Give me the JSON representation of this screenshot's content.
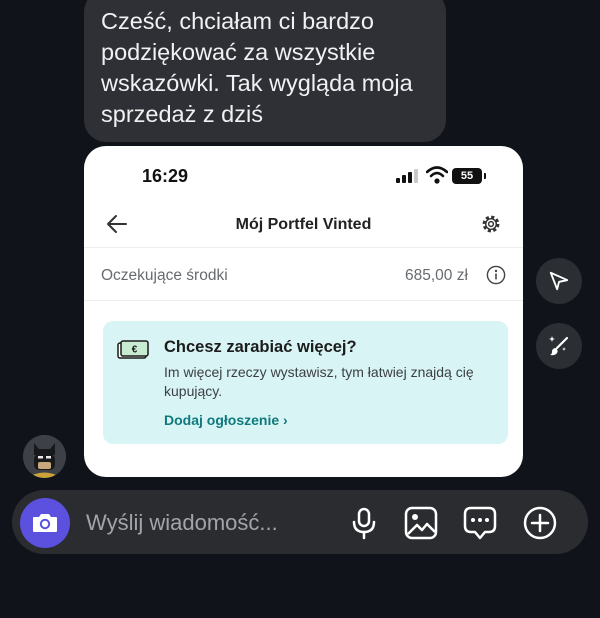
{
  "message": {
    "text": "Cześć, chciałam ci bardzo podziękować za wszystkie wskazówki. Tak wygląda moja sprzedaż z dziś"
  },
  "screenshot": {
    "status_bar": {
      "time": "16:29",
      "battery": "55"
    },
    "header": {
      "title": "Mój Portfel Vinted"
    },
    "pending": {
      "label": "Oczekujące środki",
      "amount": "685,00 zł"
    },
    "promo": {
      "title": "Chcesz zarabiać więcej?",
      "text": "Im więcej rzeczy wystawisz, tym łatwiej znajdą cię kupujący.",
      "link": "Dodaj ogłoszenie ›"
    }
  },
  "composer": {
    "placeholder": "Wyślij wiadomość..."
  },
  "icons": {
    "share": "paper-plane-icon",
    "ai_edit": "magic-brush-icon",
    "camera": "camera-icon",
    "mic": "microphone-icon",
    "gallery": "image-icon",
    "sticker": "chat-bubble-icon",
    "plus": "plus-circle-icon"
  },
  "colors": {
    "background": "#10131a",
    "bubble": "#2e3035",
    "camera_accent": "#5b51de",
    "promo_bg": "#d9f4f4",
    "link": "#0e7a7d"
  }
}
